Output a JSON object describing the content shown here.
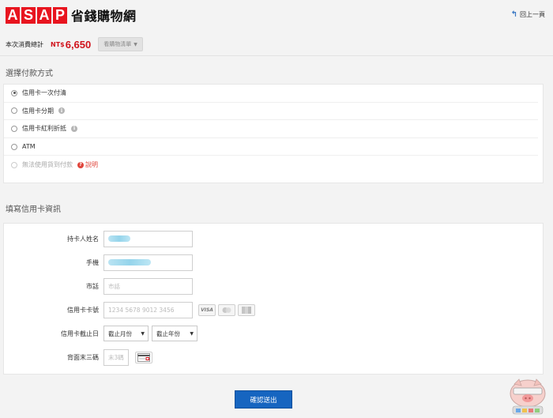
{
  "header": {
    "logo_letters": [
      "A",
      "S",
      "A",
      "P"
    ],
    "logo_text": "省錢購物網",
    "back_link": "回上一頁"
  },
  "order": {
    "total_label": "本次消費總計",
    "currency": "NT$",
    "amount": "6,650",
    "list_button": "看購物清單"
  },
  "payment": {
    "section_title": "選擇付款方式",
    "options": [
      {
        "label": "信用卡一次付清",
        "checked": true
      },
      {
        "label": "信用卡分期",
        "info": "i"
      },
      {
        "label": "信用卡紅利折抵",
        "info": "i"
      },
      {
        "label": "ATM"
      },
      {
        "label": "無法使用貨到付款",
        "disabled": true,
        "help": "?",
        "help_link": "說明"
      }
    ]
  },
  "card_form": {
    "section_title": "填寫信用卡資訊",
    "fields": {
      "name_label": "持卡人姓名",
      "mobile_label": "手機",
      "phone_label": "市話",
      "phone_placeholder": "市話",
      "card_label": "信用卡卡號",
      "card_placeholder": "1234 5678 9012 3456",
      "expiry_label": "信用卡截止日",
      "month_option": "截止月份",
      "year_option": "截止年份",
      "cvv_label": "背面末三碼",
      "cvv_placeholder": "末3碼"
    },
    "card_logos": [
      "VISA"
    ]
  },
  "submit_label": "確認送出",
  "colors": {
    "brand_red": "#e8141f",
    "price_red": "#d0141d",
    "primary_blue": "#1665c0"
  }
}
